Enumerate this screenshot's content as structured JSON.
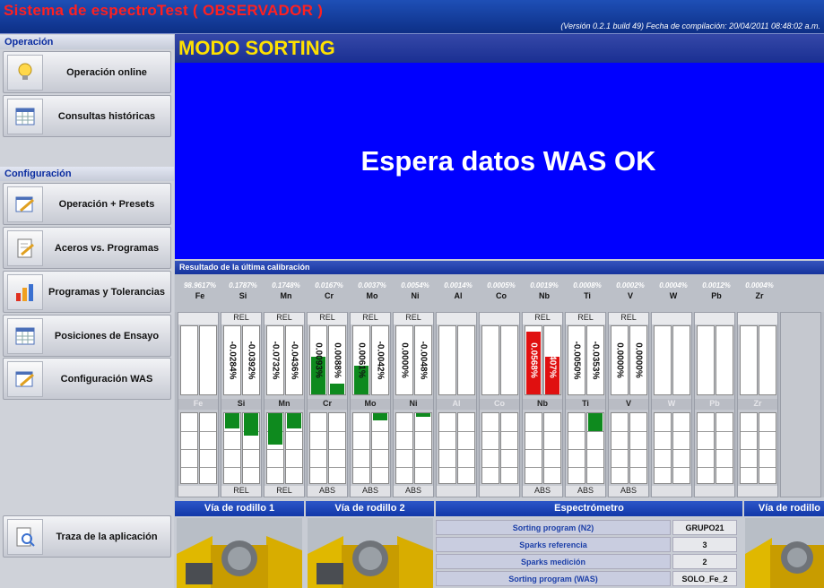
{
  "window": {
    "title": "Sistema de espectroTest ( OBSERVADOR )",
    "version": "(Versión 0.2.1 build 49) Fecha de compilación: 20/04/2011 08:48:02 a.m."
  },
  "sidebar": {
    "operacion_title": "Operación",
    "configuracion_title": "Configuración",
    "items": [
      {
        "label": "Operación online",
        "icon": "lightbulb-icon"
      },
      {
        "label": "Consultas históricas",
        "icon": "table-icon"
      },
      {
        "label": "Operación + Presets",
        "icon": "edit-form-icon"
      },
      {
        "label": "Aceros vs. Programas",
        "icon": "edit-document-icon"
      },
      {
        "label": "Programas y Tolerancias",
        "icon": "bar-chart-icon"
      },
      {
        "label": "Posiciones de Ensayo",
        "icon": "table-icon"
      },
      {
        "label": "Configuración WAS",
        "icon": "edit-form-icon"
      },
      {
        "label": "Traza de la aplicación",
        "icon": "magnifier-document-icon"
      }
    ]
  },
  "main": {
    "mode_title": "MODO SORTING",
    "message": "Espera datos WAS OK",
    "calibration_title": "Resultado de la última calibración",
    "calibration": [
      {
        "pct": "98.9617%",
        "el": "Fe"
      },
      {
        "pct": "0.1787%",
        "el": "Si"
      },
      {
        "pct": "0.1748%",
        "el": "Mn"
      },
      {
        "pct": "0.0167%",
        "el": "Cr"
      },
      {
        "pct": "0.0037%",
        "el": "Mo"
      },
      {
        "pct": "0.0054%",
        "el": "Ni"
      },
      {
        "pct": "0.0014%",
        "el": "Al"
      },
      {
        "pct": "0.0005%",
        "el": "Co"
      },
      {
        "pct": "0.0019%",
        "el": "Nb"
      },
      {
        "pct": "0.0008%",
        "el": "Ti"
      },
      {
        "pct": "0.0002%",
        "el": "V"
      },
      {
        "pct": "0.0004%",
        "el": "W"
      },
      {
        "pct": "0.0012%",
        "el": "Pb"
      },
      {
        "pct": "0.0004%",
        "el": "Zr"
      }
    ],
    "columns": [
      {
        "el": "Fe",
        "top": "",
        "bottom": "",
        "v1": "",
        "v2": "",
        "active": false,
        "c1": "",
        "c2": "",
        "f1": 0,
        "f2": 0,
        "d1": 0,
        "d2": 0
      },
      {
        "el": "Si",
        "top": "REL",
        "bottom": "REL",
        "v1": "-0.0284%",
        "v2": "-0.0392%",
        "active": true,
        "c1": "",
        "c2": "",
        "f1": 0,
        "f2": 0,
        "d1": 0.22,
        "d2": 0.32
      },
      {
        "el": "Mn",
        "top": "REL",
        "bottom": "REL",
        "v1": "-0.0732%",
        "v2": "-0.0436%",
        "active": true,
        "c1": "",
        "c2": "",
        "f1": 0,
        "f2": 0,
        "d1": 0.45,
        "d2": 0.22
      },
      {
        "el": "Cr",
        "top": "REL",
        "bottom": "ABS",
        "v1": "0.0093%",
        "v2": "0.0088%",
        "active": true,
        "c1": "green",
        "c2": "green",
        "f1": 0.55,
        "f2": 0.16,
        "d1": 0,
        "d2": 0
      },
      {
        "el": "Mo",
        "top": "REL",
        "bottom": "ABS",
        "v1": "0.0061%",
        "v2": "-0.0042%",
        "active": true,
        "c1": "green",
        "c2": "",
        "f1": 0.42,
        "f2": 0,
        "d1": 0,
        "d2": 0.1
      },
      {
        "el": "Ni",
        "top": "REL",
        "bottom": "ABS",
        "v1": "0.0000%",
        "v2": "-0.0048%",
        "active": true,
        "c1": "",
        "c2": "",
        "f1": 0,
        "f2": 0,
        "d1": 0,
        "d2": 0.05
      },
      {
        "el": "Al",
        "top": "",
        "bottom": "",
        "v1": "",
        "v2": "",
        "active": false,
        "c1": "",
        "c2": "",
        "f1": 0,
        "f2": 0,
        "d1": 0,
        "d2": 0
      },
      {
        "el": "Co",
        "top": "",
        "bottom": "",
        "v1": "",
        "v2": "",
        "active": false,
        "c1": "",
        "c2": "",
        "f1": 0,
        "f2": 0,
        "d1": 0,
        "d2": 0
      },
      {
        "el": "Nb",
        "top": "REL",
        "bottom": "ABS",
        "v1": "0.0568%",
        "v2": "0.0407%",
        "active": true,
        "c1": "red",
        "c2": "red",
        "f1": 0.92,
        "f2": 0.55,
        "d1": 0,
        "d2": 0
      },
      {
        "el": "Ti",
        "top": "REL",
        "bottom": "ABS",
        "v1": "-0.0050%",
        "v2": "-0.0353%",
        "active": true,
        "c1": "",
        "c2": "",
        "f1": 0,
        "f2": 0,
        "d1": 0,
        "d2": 0.25
      },
      {
        "el": "V",
        "top": "REL",
        "bottom": "ABS",
        "v1": "0.0000%",
        "v2": "0.0000%",
        "active": true,
        "c1": "",
        "c2": "",
        "f1": 0,
        "f2": 0,
        "d1": 0,
        "d2": 0
      },
      {
        "el": "W",
        "top": "",
        "bottom": "",
        "v1": "",
        "v2": "",
        "active": false,
        "c1": "",
        "c2": "",
        "f1": 0,
        "f2": 0,
        "d1": 0,
        "d2": 0
      },
      {
        "el": "Pb",
        "top": "",
        "bottom": "",
        "v1": "",
        "v2": "",
        "active": false,
        "c1": "",
        "c2": "",
        "f1": 0,
        "f2": 0,
        "d1": 0,
        "d2": 0
      },
      {
        "el": "Zr",
        "top": "",
        "bottom": "",
        "v1": "",
        "v2": "",
        "active": false,
        "c1": "",
        "c2": "",
        "f1": 0,
        "f2": 0,
        "d1": 0,
        "d2": 0
      }
    ],
    "bottom": {
      "via1": "Vía de rodillo 1",
      "via2": "Vía de rodillo 2",
      "espectrometro": "Espectrómetro",
      "via_right": "Vía de rodillo",
      "table": [
        {
          "k": "Sorting program (N2)",
          "v": "GRUPO21"
        },
        {
          "k": "Sparks referencia",
          "v": "3"
        },
        {
          "k": "Sparks medición",
          "v": "2"
        },
        {
          "k": "Sorting program (WAS)",
          "v": "SOLO_Fe_2"
        }
      ]
    }
  },
  "colors": {
    "accent_red": "#e01010",
    "ok_green": "#0e8a1e",
    "panel_blue": "#0000ff",
    "title_yellow": "#ffe100"
  }
}
